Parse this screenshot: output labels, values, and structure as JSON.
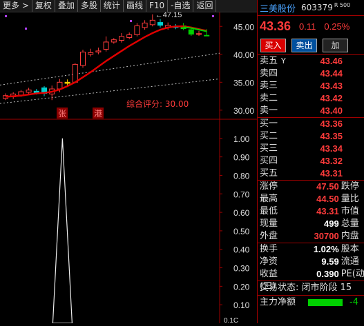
{
  "toolbar": {
    "items": [
      "更多 >",
      "复权",
      "叠加",
      "多股",
      "统计",
      "画线",
      "F10",
      "-自选",
      "返回"
    ]
  },
  "chart": {
    "price_axis": [
      "45.00",
      "40.00",
      "35.00",
      "30.00"
    ],
    "indicator_axis": [
      "1.00",
      "0.90",
      "0.80",
      "0.70",
      "0.60",
      "0.50",
      "0.40",
      "0.30",
      "0.20",
      "0.10"
    ],
    "bottom_axis_value": "0.1C",
    "high_marker": "47.15",
    "score_label": "综合评分: 30.00",
    "tag_zhang": "张",
    "tag_gang": "港"
  },
  "stock": {
    "name": "三美股份",
    "code": "603379",
    "code_sup": "R 500",
    "price": "43.36",
    "change": "0.11",
    "change_pct": "0.25%"
  },
  "buttons": {
    "buy": "买入",
    "sell": "卖出",
    "watch": "加"
  },
  "orderbook": {
    "asks": [
      {
        "label": "卖五",
        "price": "43.46",
        "flag": "Y"
      },
      {
        "label": "卖四",
        "price": "43.44"
      },
      {
        "label": "卖三",
        "price": "43.43"
      },
      {
        "label": "卖二",
        "price": "43.42"
      },
      {
        "label": "卖一",
        "price": "43.40"
      }
    ],
    "bids": [
      {
        "label": "买一",
        "price": "43.36"
      },
      {
        "label": "买二",
        "price": "43.35"
      },
      {
        "label": "买三",
        "price": "43.34"
      },
      {
        "label": "买四",
        "price": "43.32"
      },
      {
        "label": "买五",
        "price": "43.31"
      }
    ]
  },
  "stats": [
    {
      "label": "涨停",
      "value": "47.50",
      "right": "跌停"
    },
    {
      "label": "最高",
      "value": "44.50",
      "right": "量比"
    },
    {
      "label": "最低",
      "value": "43.31",
      "right": "市值"
    },
    {
      "label": "现量",
      "value": "499",
      "right": "总量"
    },
    {
      "label": "外盘",
      "value": "30700",
      "right": "内盘"
    }
  ],
  "stats2": [
    {
      "label": "换手",
      "value": "1.02%",
      "right": "股本"
    },
    {
      "label": "净资",
      "value": "9.59",
      "right": "流通"
    },
    {
      "label": "收益(三)",
      "value": "0.390",
      "right": "PE(动"
    }
  ],
  "bottom": {
    "status": "交易状态: 闭市阶段 15",
    "flow_label": "主力净额",
    "flow_value": "-4"
  },
  "colors": {
    "up": "#ff3b3b",
    "down": "#00d000",
    "accent": "#4aa3ff",
    "border": "#a00000"
  },
  "chart_data": {
    "type": "candlestick",
    "panels": [
      {
        "name": "price",
        "ylim": [
          28.5,
          47.5
        ],
        "ticks": [
          45,
          40,
          35,
          30
        ]
      },
      {
        "name": "indicator",
        "ylim": [
          0,
          1.1
        ],
        "ticks": [
          1.0,
          0.9,
          0.8,
          0.7,
          0.6,
          0.5,
          0.4,
          0.3,
          0.2,
          0.1
        ]
      }
    ],
    "candles": [
      {
        "o": 32.1,
        "c": 32.6,
        "h": 33.0,
        "l": 31.8
      },
      {
        "o": 32.4,
        "c": 32.9,
        "h": 33.2,
        "l": 32.0
      },
      {
        "o": 32.7,
        "c": 33.3,
        "h": 33.6,
        "l": 32.4
      },
      {
        "o": 33.2,
        "c": 33.6,
        "h": 34.0,
        "l": 32.9
      },
      {
        "o": 33.4,
        "c": 33.1,
        "h": 33.8,
        "l": 32.8
      },
      {
        "o": 34.0,
        "c": 33.0,
        "h": 34.3,
        "l": 32.5
      },
      {
        "o": 32.9,
        "c": 33.8,
        "h": 34.4,
        "l": 31.8
      },
      {
        "o": 33.8,
        "c": 35.0,
        "h": 35.6,
        "l": 33.2
      },
      {
        "o": 34.8,
        "c": 35.0,
        "h": 35.5,
        "l": 34.2
      },
      {
        "o": 35.0,
        "c": 38.2,
        "h": 38.4,
        "l": 34.8
      },
      {
        "o": 38.0,
        "c": 40.4,
        "h": 40.8,
        "l": 37.6
      },
      {
        "o": 40.0,
        "c": 40.3,
        "h": 41.0,
        "l": 39.6
      },
      {
        "o": 40.4,
        "c": 40.6,
        "h": 41.2,
        "l": 40.0
      },
      {
        "o": 40.9,
        "c": 42.2,
        "h": 43.2,
        "l": 40.5
      },
      {
        "o": 42.2,
        "c": 42.6,
        "h": 42.9,
        "l": 41.9
      },
      {
        "o": 42.5,
        "c": 43.2,
        "h": 43.8,
        "l": 42.1
      },
      {
        "o": 43.0,
        "c": 43.5,
        "h": 43.9,
        "l": 42.7
      },
      {
        "o": 43.5,
        "c": 45.1,
        "h": 45.6,
        "l": 43.2
      },
      {
        "o": 44.8,
        "c": 45.6,
        "h": 46.1,
        "l": 44.4
      },
      {
        "o": 45.3,
        "c": 46.1,
        "h": 47.15,
        "l": 45.0
      },
      {
        "o": 45.7,
        "c": 45.2,
        "h": 46.3,
        "l": 44.8
      },
      {
        "o": 44.8,
        "c": 45.2,
        "h": 45.7,
        "l": 44.4
      },
      {
        "o": 45.0,
        "c": 44.8,
        "h": 45.4,
        "l": 44.5
      },
      {
        "o": 45.1,
        "c": 44.6,
        "h": 45.6,
        "l": 44.3
      },
      {
        "o": 44.4,
        "c": 43.6,
        "h": 44.8,
        "l": 43.3
      },
      {
        "o": 43.6,
        "c": 43.7,
        "h": 44.2,
        "l": 43.3
      },
      {
        "o": 43.4,
        "c": 43.36,
        "h": 44.5,
        "l": 43.31
      }
    ],
    "ma": [
      32.4,
      32.5,
      32.6,
      32.8,
      33.0,
      33.1,
      33.3,
      33.7,
      34.3,
      35.0,
      35.9,
      36.8,
      37.8,
      38.8,
      39.7,
      40.6,
      41.5,
      42.3,
      43.1,
      43.8,
      44.4,
      44.8,
      45.0,
      45.0,
      44.8,
      44.5,
      44.2
    ],
    "indicator_peak": {
      "index": 7,
      "value": 1.0
    }
  }
}
